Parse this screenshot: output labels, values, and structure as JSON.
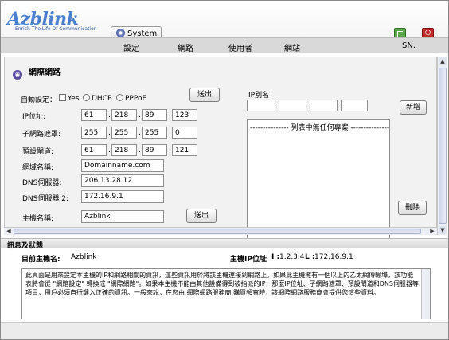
{
  "header": {
    "brand": "Azblink",
    "tagline": "Enrich The Life Of Communication",
    "active_tab": "System",
    "menu": [
      "設定",
      "網路",
      "使用者",
      "網站",
      "SN."
    ]
  },
  "page": {
    "title": "網際網路",
    "auto_config_label": "自動設定：",
    "options": {
      "yes": "Yes",
      "dhcp": "DHCP",
      "pppoe": "PPPoE"
    },
    "send_label": "送出",
    "ip_label": "IP位址:",
    "ip": [
      "61",
      "218",
      "89",
      "123"
    ],
    "mask_label": "子網路遮罩:",
    "mask": [
      "255",
      "255",
      "255",
      "0"
    ],
    "gateway_label": "預設閘道:",
    "gateway": [
      "61",
      "218",
      "89",
      "121"
    ],
    "domain_label": "網域名稱:",
    "domain_value": "Domainname.com",
    "dns1_label": "DNS伺服器:",
    "dns1_value": "206.13.28.12",
    "dns2_label": "DNS伺服器 2:",
    "dns2_value": "172.16.9.1",
    "host_label": "主機名稱:",
    "host_value": "Azblink",
    "alias_label": "IP別名",
    "add_label": "新增",
    "delete_label": "刪除",
    "alias_empty": "--------------- 列表中無任何專案 ---------------"
  },
  "status": {
    "header": "訊息及狀態",
    "host_label": "目前主機名:",
    "host_value": "Azblink",
    "ip_label": "主機IP位址",
    "ip_i_label": "I :",
    "ip_i_value": "1.2.3.4",
    "ip_l_label": "L :",
    "ip_l_value": "172.16.9.1",
    "description": "此頁面是用來設定本主機的IP和網路相關的資訊，這些資訊用於將該主機連接到網路上。如果此主機擁有一個以上的乙太網傳輸埠，該功能表將會從 \"網路設定\" 轉換成 \"網際網路\"。如果本主機不能由其他設備得到被指派的IP，那麼IP位址、子網路遮罩、預設閘道和DNS伺服器等項目，用戶必須自行鍵入正確的資訊。一般來說，在您由 網際網路服務商 購買頻寬時，該網際網路服務商會提供您這些資料。"
  }
}
